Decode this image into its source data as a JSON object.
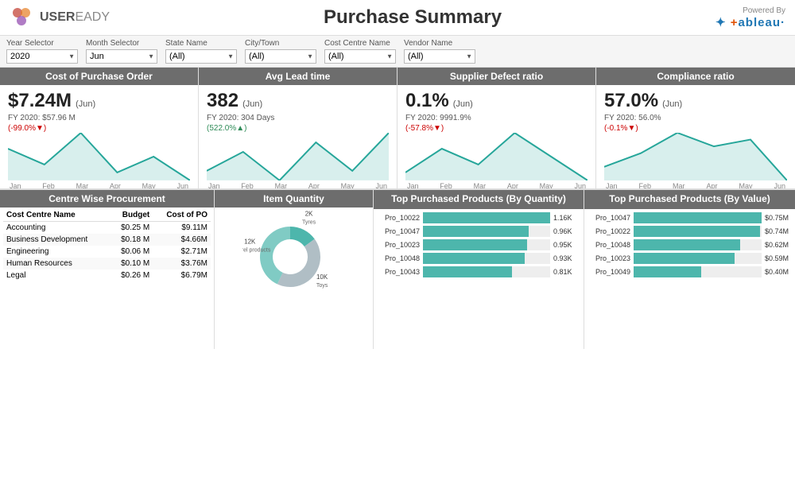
{
  "header": {
    "logo_text": "USER",
    "logo_sub": "EADY",
    "title": "Purchase Summary",
    "powered_by": "Powered By",
    "tableau": "✦ +ableau"
  },
  "filters": [
    {
      "label": "Year Selector",
      "value": "2020"
    },
    {
      "label": "Month Selector",
      "value": "Jun"
    },
    {
      "label": "State Name",
      "value": "(All)"
    },
    {
      "label": "City/Town",
      "value": "(All)"
    },
    {
      "label": "Cost Centre Name",
      "value": "(All)"
    },
    {
      "label": "Vendor Name",
      "value": "(All)"
    }
  ],
  "kpis": [
    {
      "header": "Cost of Purchase Order",
      "value": "$7.24M",
      "period": "(Jun)",
      "sub1": "FY 2020: $57.96 M",
      "sub2": "(-99.0%▼)",
      "sub2_class": "neg",
      "sparkline": [
        40,
        30,
        50,
        25,
        35,
        20
      ],
      "axis": [
        "Jan",
        "Feb",
        "Mar",
        "Apr",
        "May",
        "Jun"
      ]
    },
    {
      "header": "Avg Lead time",
      "value": "382",
      "period": "(Jun)",
      "sub1": "FY 2020: 304 Days",
      "sub2": "(522.0%▲)",
      "sub2_class": "pos",
      "sparkline": [
        30,
        40,
        25,
        45,
        30,
        50
      ],
      "axis": [
        "Jan",
        "Feb",
        "Mar",
        "Apr",
        "May",
        "Jun"
      ]
    },
    {
      "header": "Supplier Defect ratio",
      "value": "0.1%",
      "period": "(Jun)",
      "sub1": "FY 2020: 9991.9%",
      "sub2": "(-57.8%▼)",
      "sub2_class": "neg",
      "sparkline": [
        35,
        50,
        40,
        60,
        45,
        30
      ],
      "axis": [
        "Jan",
        "Feb",
        "Mar",
        "Apr",
        "May",
        "Jun"
      ]
    },
    {
      "header": "Compliance ratio",
      "value": "57.0%",
      "period": "(Jun)",
      "sub1": "FY 2020: 56.0%",
      "sub2": "(-0.1%▼)",
      "sub2_class": "neg",
      "sparkline": [
        60,
        62,
        65,
        63,
        64,
        58
      ],
      "axis": [
        "Jan",
        "Feb",
        "Mar",
        "Apr",
        "May",
        "Jun"
      ]
    }
  ],
  "centre_wise": {
    "header": "Centre Wise Procurement",
    "columns": [
      "Cost Centre Name",
      "Budget",
      "Cost of PO"
    ],
    "rows": [
      [
        "Accounting",
        "$0.25 M",
        "$9.11M"
      ],
      [
        "Business Development",
        "$0.18 M",
        "$4.66M"
      ],
      [
        "Engineering",
        "$0.06 M",
        "$2.71M"
      ],
      [
        "Human Resources",
        "$0.10 M",
        "$3.76M"
      ],
      [
        "Legal",
        "$0.26 M",
        "$6.79M"
      ]
    ]
  },
  "item_quantity": {
    "header": "Item Quantity",
    "segments": [
      {
        "label": "Tyres",
        "value": "2K",
        "color": "#4db6ac",
        "pct": 15
      },
      {
        "label": "Toys",
        "value": "10K",
        "color": "#b0bec5",
        "pct": 42
      },
      {
        "label": "apparel products",
        "value": "12K",
        "color": "#80cbc4",
        "pct": 43
      }
    ]
  },
  "top_qty": {
    "header": "Top Purchased Products   (By Quantity)",
    "rows": [
      {
        "label": "Pro_10022",
        "val": "1.16K",
        "pct": 100
      },
      {
        "label": "Pro_10047",
        "val": "0.96K",
        "pct": 83
      },
      {
        "label": "Pro_10023",
        "val": "0.95K",
        "pct": 82
      },
      {
        "label": "Pro_10048",
        "val": "0.93K",
        "pct": 80
      },
      {
        "label": "Pro_10043",
        "val": "0.81K",
        "pct": 70
      }
    ]
  },
  "top_value": {
    "header": "Top Purchased Products   (By Value)",
    "rows": [
      {
        "label": "Pro_10047",
        "val": "$0.75M",
        "pct": 100
      },
      {
        "label": "Pro_10022",
        "val": "$0.74M",
        "pct": 99
      },
      {
        "label": "Pro_10048",
        "val": "$0.62M",
        "pct": 83
      },
      {
        "label": "Pro_10023",
        "val": "$0.59M",
        "pct": 79
      },
      {
        "label": "Pro_10049",
        "val": "$0.40M",
        "pct": 53
      }
    ]
  }
}
